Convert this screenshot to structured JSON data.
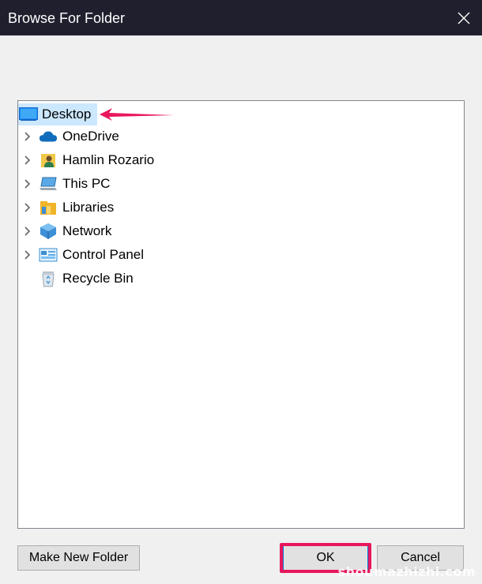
{
  "window": {
    "title": "Browse For Folder",
    "close_icon": "close-icon"
  },
  "tree": {
    "items": [
      {
        "label": "Desktop",
        "icon": "desktop-icon",
        "expandable": false,
        "selected": true
      },
      {
        "label": "OneDrive",
        "icon": "cloud-icon",
        "expandable": true
      },
      {
        "label": "Hamlin Rozario",
        "icon": "user-folder-icon",
        "expandable": true
      },
      {
        "label": "This PC",
        "icon": "computer-icon",
        "expandable": true
      },
      {
        "label": "Libraries",
        "icon": "libraries-icon",
        "expandable": true
      },
      {
        "label": "Network",
        "icon": "network-icon",
        "expandable": true
      },
      {
        "label": "Control Panel",
        "icon": "control-panel-icon",
        "expandable": true
      },
      {
        "label": "Recycle Bin",
        "icon": "recycle-bin-icon",
        "expandable": false
      }
    ]
  },
  "buttons": {
    "make_new_folder": "Make New Folder",
    "ok": "OK",
    "cancel": "Cancel"
  },
  "annotations": {
    "highlight_color": "#e8175d",
    "watermark": "shoumazhizhi.com"
  },
  "colors": {
    "titlebar": "#1f1f2e",
    "selection": "#cce8ff",
    "background": "#f0f0f0"
  }
}
